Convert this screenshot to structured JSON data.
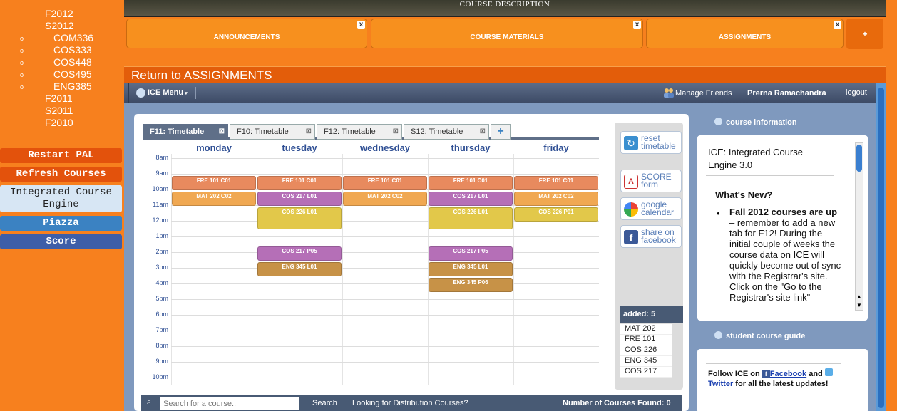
{
  "sidebar": {
    "terms_top": [
      "F2012",
      "S2012"
    ],
    "courses": [
      "COM336",
      "COS333",
      "COS448",
      "COS495",
      "ENG385"
    ],
    "terms_bottom": [
      "F2011",
      "S2011",
      "F2010"
    ],
    "buttons": [
      "Restart PAL",
      "Refresh Courses",
      "Integrated Course Engine",
      "Piazza",
      "Score"
    ]
  },
  "banner": {
    "title": "COURSE DESCRIPTION"
  },
  "top_tabs": [
    "ANNOUNCEMENTS",
    "COURSE MATERIALS",
    "ASSIGNMENTS",
    "+"
  ],
  "close_glyph": "x",
  "return_text": "Return to ASSIGNMENTS",
  "ice_bar": {
    "menu_label": "ICE Menu",
    "manage_friends": "Manage Friends",
    "user_name": "Prerna Ramachandra",
    "logout": "logout"
  },
  "timetable_tabs": [
    {
      "label": "F11: Timetable",
      "active": true
    },
    {
      "label": "F10: Timetable",
      "active": false
    },
    {
      "label": "F12: Timetable",
      "active": false
    },
    {
      "label": "S12: Timetable",
      "active": false
    }
  ],
  "days": [
    "monday",
    "tuesday",
    "wednesday",
    "thursday",
    "friday"
  ],
  "hours": [
    "8am",
    "9am",
    "10am",
    "11am",
    "12pm",
    "1pm",
    "2pm",
    "3pm",
    "4pm",
    "5pm",
    "6pm",
    "7pm",
    "8pm",
    "9pm",
    "10pm"
  ],
  "events": [
    {
      "label": "FRE 101 C01",
      "day": 0,
      "start": 9,
      "end": 10,
      "color": "#e88a5e"
    },
    {
      "label": "FRE 101 C01",
      "day": 1,
      "start": 9,
      "end": 10,
      "color": "#e88a5e"
    },
    {
      "label": "FRE 101 C01",
      "day": 2,
      "start": 9,
      "end": 10,
      "color": "#e88a5e"
    },
    {
      "label": "FRE 101 C01",
      "day": 3,
      "start": 9,
      "end": 10,
      "color": "#e88a5e"
    },
    {
      "label": "FRE 101 C01",
      "day": 4,
      "start": 9,
      "end": 10,
      "color": "#e88a5e"
    },
    {
      "label": "MAT 202 C02",
      "day": 0,
      "start": 10,
      "end": 11,
      "color": "#f0a852"
    },
    {
      "label": "COS 217 L01",
      "day": 1,
      "start": 10,
      "end": 11,
      "color": "#b56fb7"
    },
    {
      "label": "MAT 202 C02",
      "day": 2,
      "start": 10,
      "end": 11,
      "color": "#f0a852"
    },
    {
      "label": "COS 217 L01",
      "day": 3,
      "start": 10,
      "end": 11,
      "color": "#b56fb7"
    },
    {
      "label": "MAT 202 C02",
      "day": 4,
      "start": 10,
      "end": 11,
      "color": "#f0a852"
    },
    {
      "label": "COS 226 L01",
      "day": 1,
      "start": 11,
      "end": 12.5,
      "color": "#e2c84a"
    },
    {
      "label": "COS 226 L01",
      "day": 3,
      "start": 11,
      "end": 12.5,
      "color": "#e2c84a"
    },
    {
      "label": "COS 226 P01",
      "day": 4,
      "start": 11,
      "end": 12,
      "color": "#e2c84a"
    },
    {
      "label": "COS 217 P05",
      "day": 1,
      "start": 13.5,
      "end": 14.5,
      "color": "#b56fb7"
    },
    {
      "label": "COS 217 P05",
      "day": 3,
      "start": 13.5,
      "end": 14.5,
      "color": "#b56fb7"
    },
    {
      "label": "ENG 345 L01",
      "day": 1,
      "start": 14.5,
      "end": 15.5,
      "color": "#c79247"
    },
    {
      "label": "ENG 345 L01",
      "day": 3,
      "start": 14.5,
      "end": 15.5,
      "color": "#c79247"
    },
    {
      "label": "ENG 345 P06",
      "day": 3,
      "start": 15.5,
      "end": 16.5,
      "color": "#c79247"
    }
  ],
  "tools": [
    {
      "label": "reset timetable",
      "icon": "refresh-icon"
    },
    {
      "label": "SCORE form",
      "icon": "pdf-icon"
    },
    {
      "label": "google calendar",
      "icon": "google-icon"
    },
    {
      "label": "share on facebook",
      "icon": "facebook-icon"
    }
  ],
  "added": {
    "heading": "added: 5",
    "items": [
      "MAT 202",
      "FRE 101",
      "COS 226",
      "ENG 345",
      "COS 217"
    ]
  },
  "search": {
    "placeholder": "Search for a course..",
    "button": "Search",
    "distribution": "Looking for Distribution Courses?",
    "found": "Number of Courses Found: 0"
  },
  "course_information": {
    "heading": "course information",
    "title": "ICE: Integrated Course Engine 3.0",
    "whats_new": "What's New?",
    "news_bold": "Fall 2012 courses are up",
    "news_text": " – remember to add a new tab for F12! During the initial couple of weeks the course data on ICE will quickly become out of sync with the Registrar's site. Click on the \"Go to the Registrar's site link\""
  },
  "student_course_guide": {
    "heading": "student course guide",
    "follow_prefix": "Follow ICE on ",
    "facebook": "Facebook",
    "and": " and ",
    "twitter": "Twitter",
    "suffix": " for all the latest updates!"
  }
}
